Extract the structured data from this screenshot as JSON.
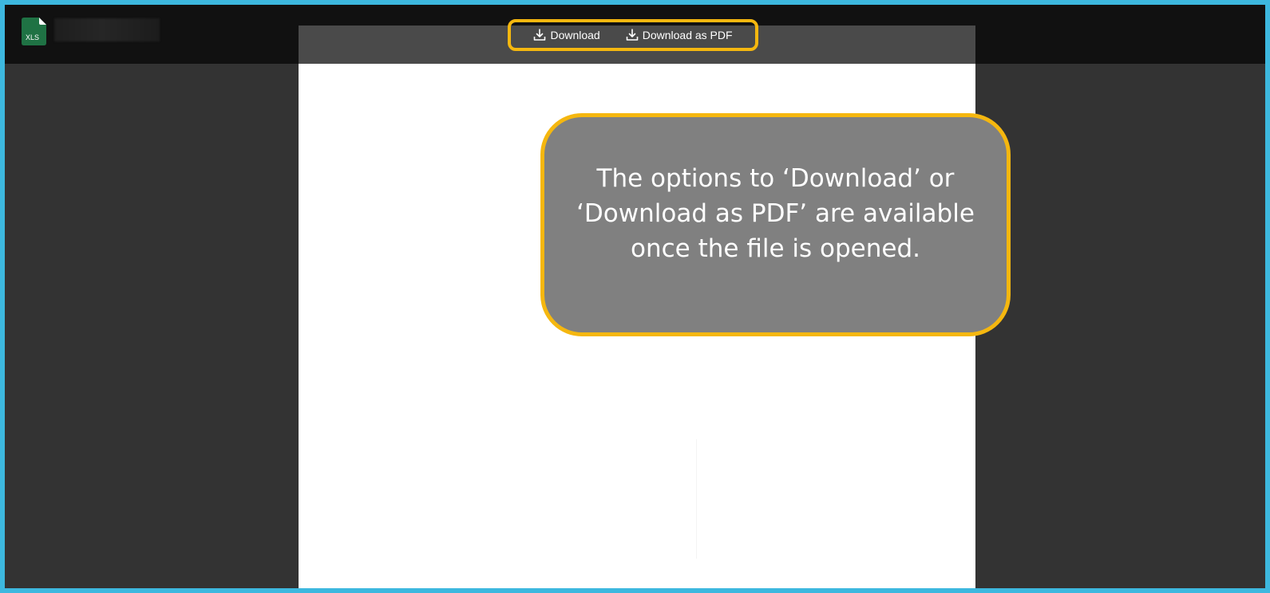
{
  "file": {
    "type_label": "XLS",
    "icon": "excel-file-icon",
    "icon_color": "#1f7244"
  },
  "toolbar": {
    "download_label": "Download",
    "download_pdf_label": "Download as PDF",
    "download_icon": "download-icon"
  },
  "callout": {
    "text": "The options to ‘Download’ or ‘Download as PDF’ are available once the file is opened."
  },
  "colors": {
    "highlight": "#f5b70f",
    "frame_border": "#3db8df",
    "callout_bg": "#808080",
    "topbar_bg": "#111111",
    "viewer_bg": "#333333"
  }
}
